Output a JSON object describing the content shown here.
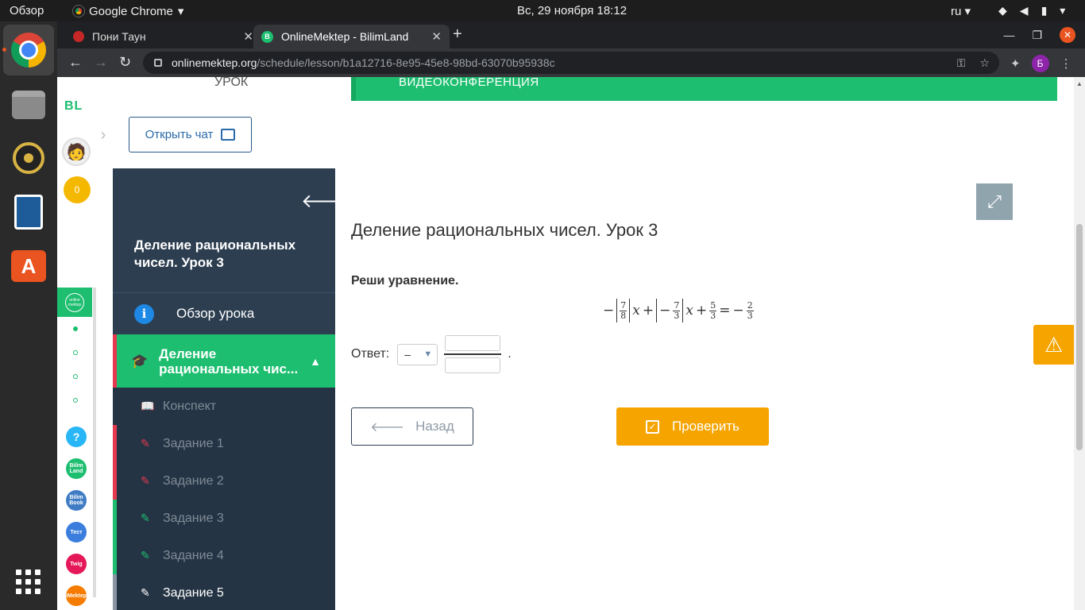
{
  "os": {
    "overview": "Обзор",
    "active_app": "Google Chrome",
    "clock": "Вс, 29 ноября  18:12",
    "lang": "ru"
  },
  "browser": {
    "tabs": [
      {
        "title": "Пони Таун",
        "active": false
      },
      {
        "title": "OnlineMektep - BilimLand",
        "active": true
      }
    ],
    "url_domain": "onlinemektep.org",
    "url_path": "/schedule/lesson/b1a12716-8e95-45e8-98bd-63070b95938c",
    "profile_initial": "Б"
  },
  "rail": {
    "logo": "BL",
    "coins": "0",
    "online_label": "online mektep",
    "help": "?",
    "bilimland": "Bilim Land",
    "bilimbook": "Bilim Book",
    "test": "Тест",
    "twig": "Twig",
    "imektep": "iMektep"
  },
  "header": {
    "lesson_tab": "УРОК",
    "video_conf": "ВИДЕОКОНФЕРЕНЦИЯ",
    "open_chat": "Открыть чат"
  },
  "sidebar": {
    "title": "Деление рациональных чисел. Урок 3",
    "overview": "Обзор урока",
    "current_line1": "Деление",
    "current_line2": "рациональных чис...",
    "items": [
      {
        "label": "Конспект",
        "state": "normal"
      },
      {
        "label": "Задание 1",
        "state": "red"
      },
      {
        "label": "Задание 2",
        "state": "red"
      },
      {
        "label": "Задание 3",
        "state": "green"
      },
      {
        "label": "Задание 4",
        "state": "green"
      },
      {
        "label": "Задание 5",
        "state": "active"
      }
    ]
  },
  "main": {
    "title": "Деление рациональных чисел. Урок 3",
    "instruction": "Реши уравнение.",
    "equation": {
      "minus1": "−",
      "f1_num": "7",
      "f1_den": "8",
      "x": "x",
      "plus1": "+",
      "minus2": "−",
      "f2_num": "7",
      "f2_den": "3",
      "plus2": "+",
      "f3_num": "5",
      "f3_den": "3",
      "eq": "=",
      "minus3": "−",
      "f4_num": "2",
      "f4_den": "3"
    },
    "answer_label": "Ответ:",
    "sign_value": "–",
    "answer_dot": ".",
    "back_button": "Назад",
    "check_button": "Проверить"
  },
  "colors": {
    "brand_green": "#1dbe6f",
    "sidebar_dark": "#2c3e50",
    "accent_orange": "#f5a400",
    "error_red": "#e53950"
  }
}
